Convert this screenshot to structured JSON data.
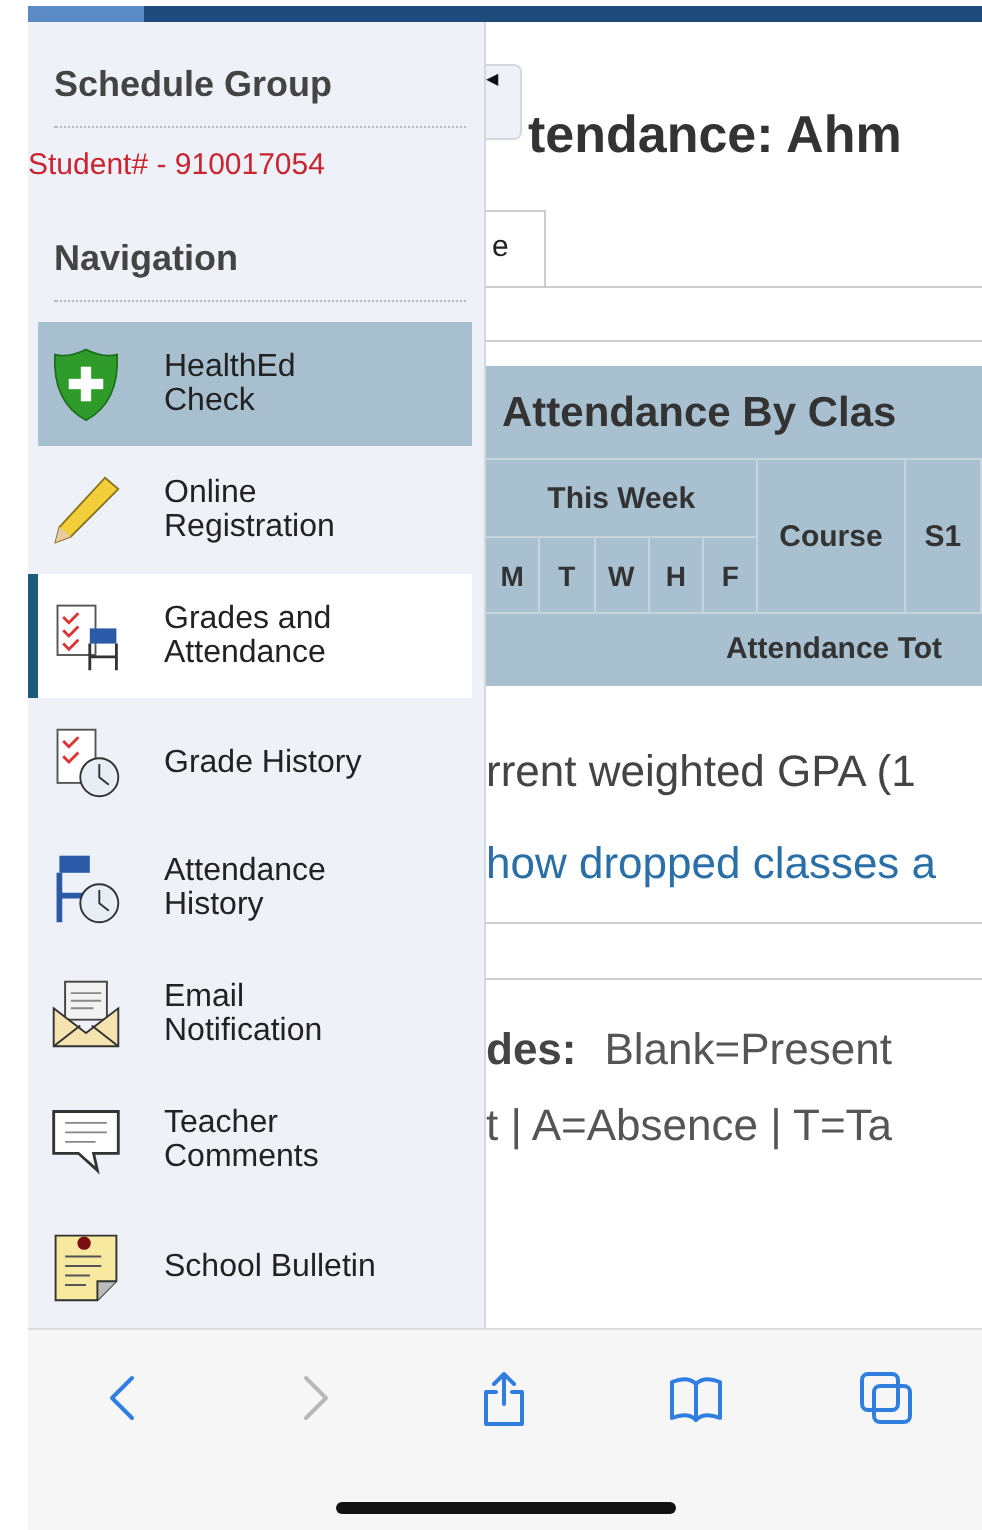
{
  "sidebar": {
    "group_title": "Schedule Group",
    "student_id": "Student# - 910017054",
    "nav_title": "Navigation",
    "items": [
      {
        "kind": "shield",
        "label": "HealthEd\nCheck",
        "highlighted": true,
        "selected": false
      },
      {
        "kind": "pencil",
        "label": "Online\nRegistration",
        "highlighted": false,
        "selected": false
      },
      {
        "kind": "grades",
        "label": "Grades and\nAttendance",
        "highlighted": false,
        "selected": true
      },
      {
        "kind": "grade-history",
        "label": "Grade History",
        "highlighted": false,
        "selected": false
      },
      {
        "kind": "attendance-history",
        "label": "Attendance\nHistory",
        "highlighted": false,
        "selected": false
      },
      {
        "kind": "email",
        "label": "Email\nNotification",
        "highlighted": false,
        "selected": false
      },
      {
        "kind": "comments",
        "label": "Teacher\nComments",
        "highlighted": false,
        "selected": false
      },
      {
        "kind": "bulletin",
        "label": "School Bulletin",
        "highlighted": false,
        "selected": false
      }
    ]
  },
  "collapse_toggle": "◀",
  "main": {
    "title": "tendance: Ahm",
    "tab": "e",
    "table": {
      "title": "Attendance By Clas",
      "week_header": "This Week",
      "days": [
        "M",
        "T",
        "W",
        "H",
        "F"
      ],
      "columns": [
        "Course",
        "S1"
      ],
      "footer": "Attendance Tot"
    },
    "gpa": "rrent weighted GPA (1",
    "dropped_link": "how dropped classes a",
    "codes_label": "des:",
    "codes_line_1": "Blank=Present",
    "codes_line_2": "t | A=Absence | T=Ta"
  },
  "toolbar": [
    {
      "kind": "back",
      "disabled": false
    },
    {
      "kind": "forward",
      "disabled": true
    },
    {
      "kind": "share",
      "disabled": false
    },
    {
      "kind": "bookmarks",
      "disabled": false
    },
    {
      "kind": "tabs",
      "disabled": false
    }
  ]
}
